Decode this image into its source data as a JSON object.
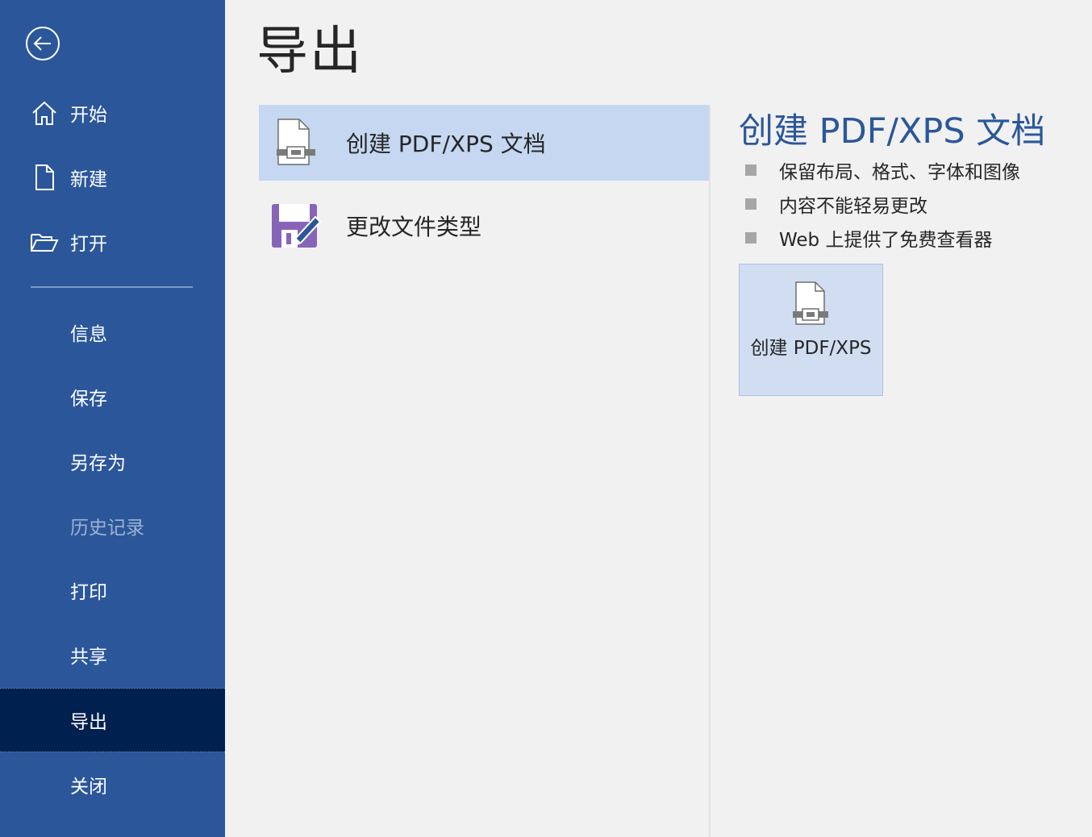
{
  "page_title": "导出",
  "sidebar": {
    "back_icon": "back-arrow-icon",
    "top_items": [
      {
        "label": "开始",
        "icon": "home-icon"
      },
      {
        "label": "新建",
        "icon": "new-document-icon"
      },
      {
        "label": "打开",
        "icon": "open-folder-icon"
      }
    ],
    "items": [
      {
        "label": "信息"
      },
      {
        "label": "保存"
      },
      {
        "label": "另存为"
      },
      {
        "label": "历史记录",
        "disabled": true
      },
      {
        "label": "打印"
      },
      {
        "label": "共享"
      },
      {
        "label": "导出",
        "selected": true
      },
      {
        "label": "关闭"
      }
    ]
  },
  "export_options": [
    {
      "label": "创建 PDF/XPS 文档",
      "icon": "pdf-document-icon",
      "selected": true
    },
    {
      "label": "更改文件类型",
      "icon": "save-edit-icon",
      "selected": false
    }
  ],
  "detail": {
    "title": "创建 PDF/XPS 文档",
    "bullets": [
      "保留布局、格式、字体和图像",
      "内容不能轻易更改",
      "Web 上提供了免费查看器"
    ],
    "button_label": "创建 PDF/XPS",
    "button_icon": "pdf-document-icon"
  },
  "colors": {
    "sidebar": "#2b579a",
    "sidebar_selected": "#002050",
    "option_selected": "#c5d7f1",
    "detail_title": "#2b579a",
    "button_bg": "#d1def2"
  }
}
